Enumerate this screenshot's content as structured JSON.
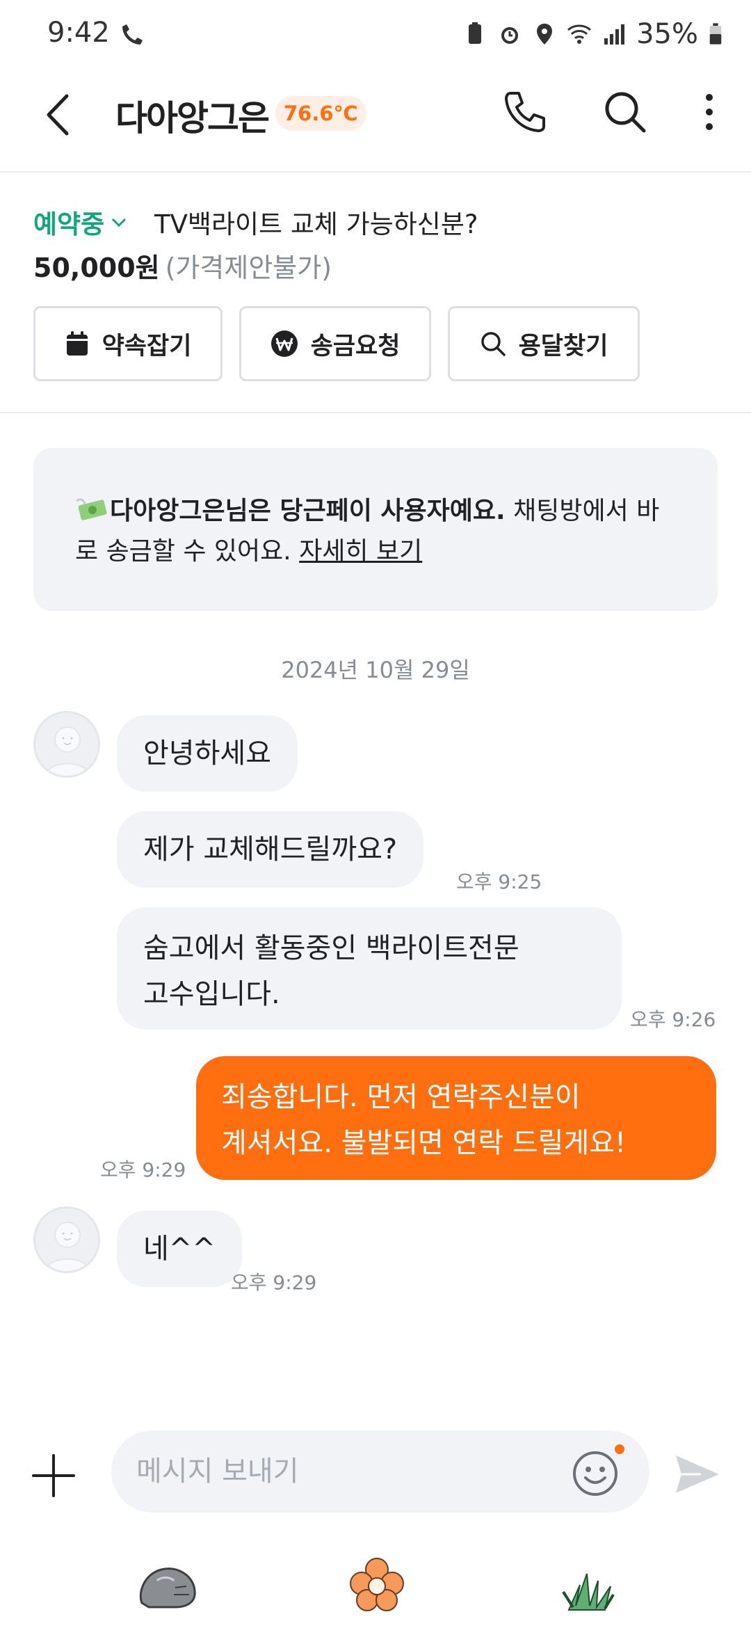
{
  "status_bar": {
    "time": "9:42",
    "battery": "35%"
  },
  "header": {
    "title": "다아앙그은",
    "temperature": "76.6℃",
    "accent_color": "#ff6f0f"
  },
  "product": {
    "status": "예약중",
    "title": "TV백라이트 교체 가능하신분?",
    "price": "50,000원",
    "price_note": "(가격제안불가)",
    "actions": [
      "약속잡기",
      "송금요청",
      "용달찾기"
    ]
  },
  "banner": {
    "bold_text": "다아앙그은님은 당근페이 사용자예요.",
    "text": " 채팅방에서 바로 송금할 수 있어요. ",
    "link": "자세히 보기"
  },
  "chat": {
    "date": "2024년 10월 29일",
    "messages": [
      {
        "text": "안녕하세요",
        "time": ""
      },
      {
        "text": "제가 교체해드릴까요?",
        "time": "오후 9:25"
      },
      {
        "line1": "숨고에서 활동중인 백라이트전문",
        "line2": "고수입니다.",
        "time": "오후 9:26"
      },
      {
        "line1": "죄송합니다. 먼저 연락주신분이",
        "line2": "계셔서요. 불발되면 연락 드릴게요!",
        "time": "오후 9:29"
      },
      {
        "text": "네^^",
        "time": "오후 9:29"
      }
    ]
  },
  "input": {
    "placeholder": "메시지 보내기"
  }
}
